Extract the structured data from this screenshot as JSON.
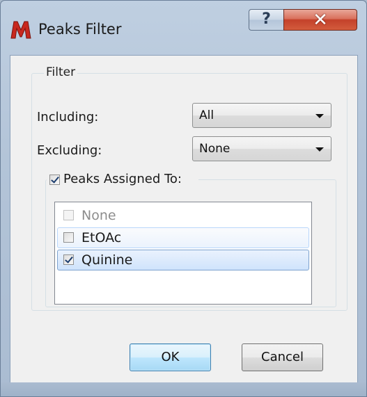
{
  "window": {
    "title": "Peaks Filter",
    "help_label": "?",
    "close_label": "✕",
    "icon": "app-logo-icon",
    "accent_color": "#c4412a"
  },
  "filter_group": {
    "label": "Filter",
    "including": {
      "label": "Including:",
      "value": "All"
    },
    "excluding": {
      "label": "Excluding:",
      "value": "None"
    },
    "peaks_assigned": {
      "label": "Peaks Assigned To:",
      "checked": true,
      "items": [
        {
          "label": "None",
          "checked": false,
          "enabled": false,
          "state": "normal"
        },
        {
          "label": "EtOAc",
          "checked": false,
          "enabled": true,
          "state": "hover"
        },
        {
          "label": "Quinine",
          "checked": true,
          "enabled": true,
          "state": "selected"
        }
      ]
    }
  },
  "buttons": {
    "ok_label": "OK",
    "cancel_label": "Cancel"
  }
}
